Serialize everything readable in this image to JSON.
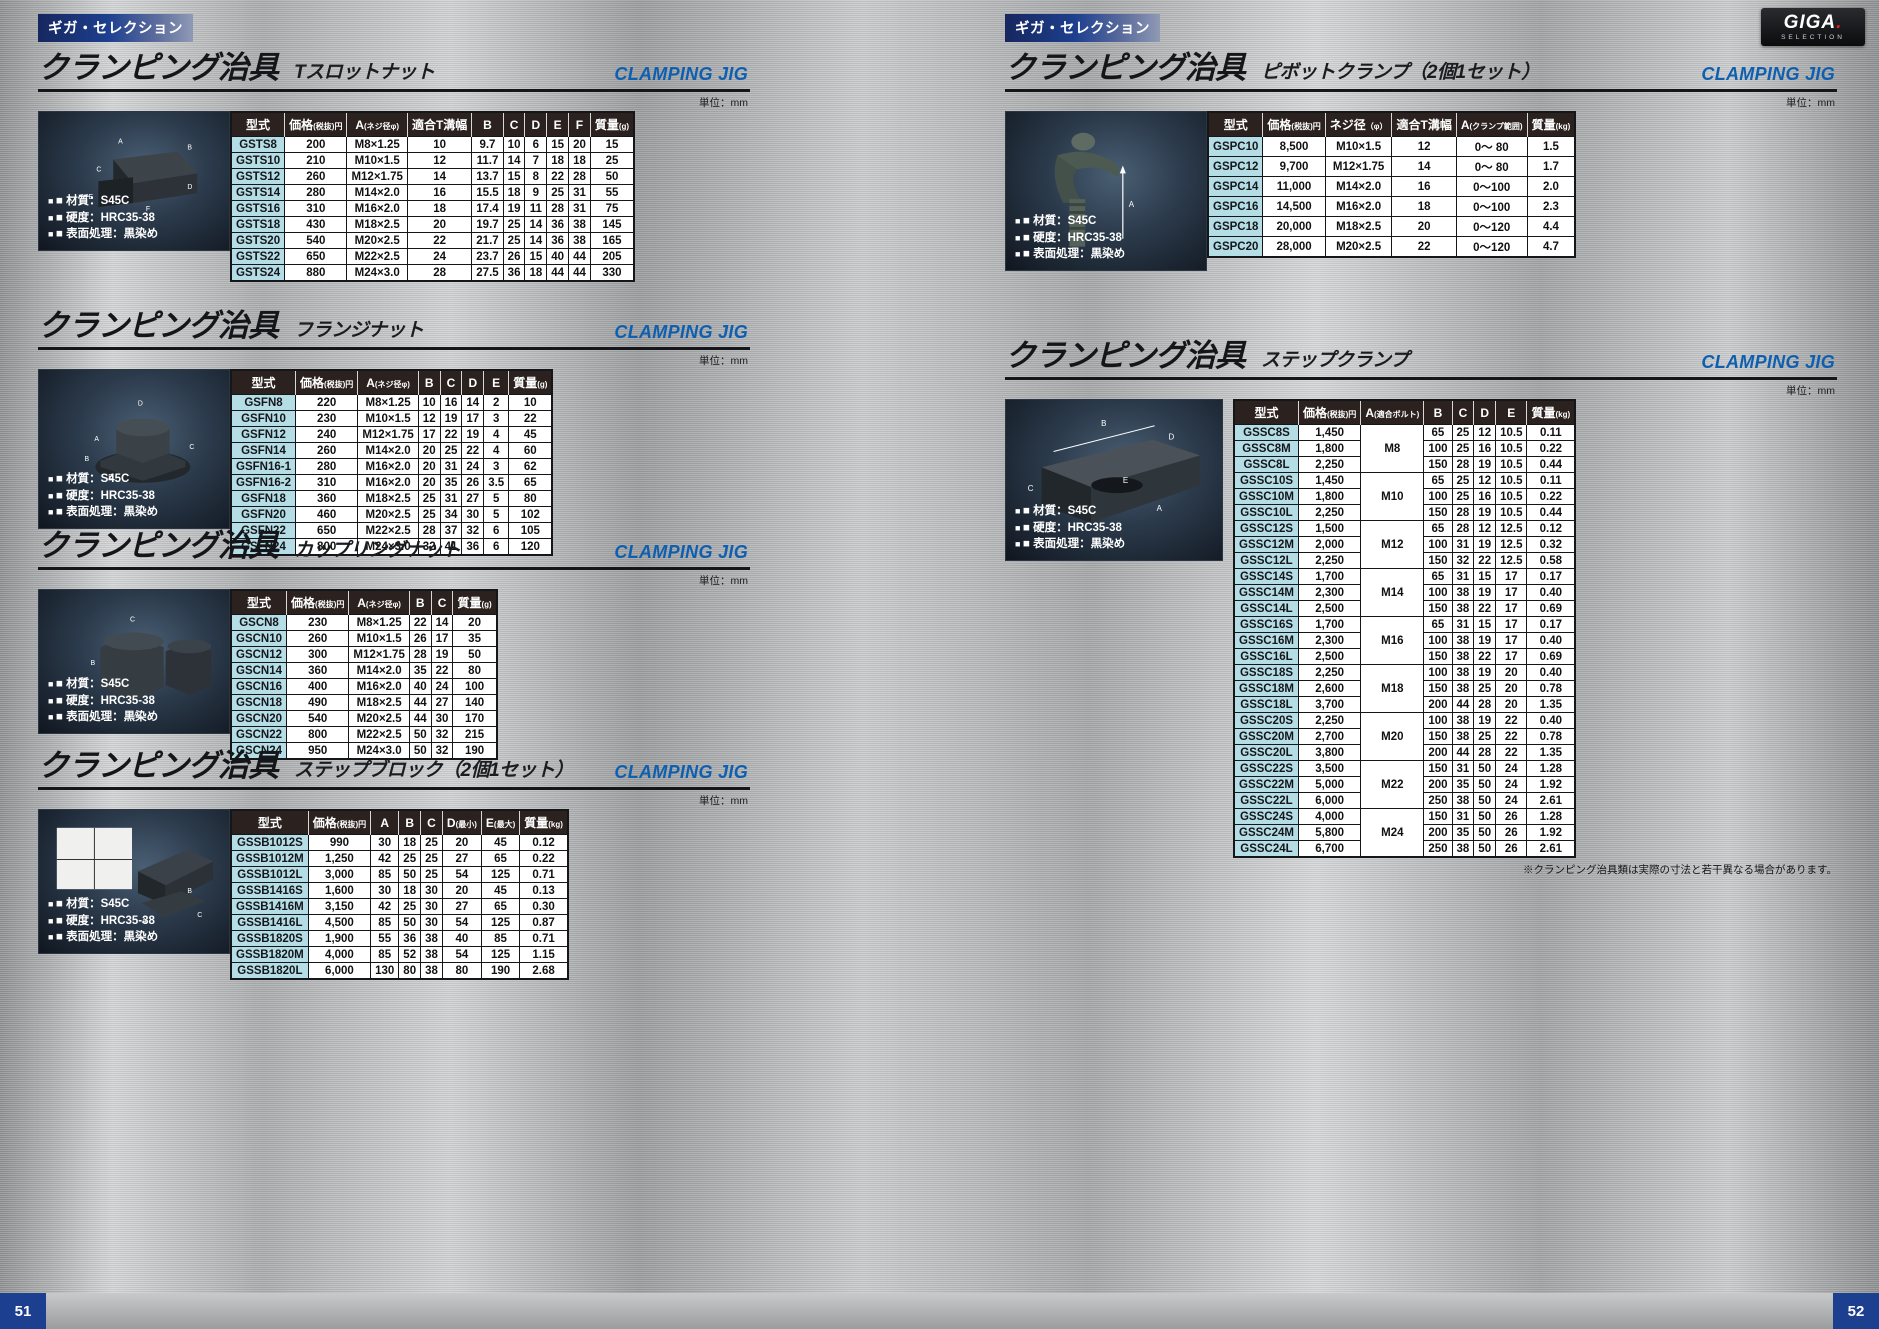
{
  "brand": {
    "tab_label": "ギガ・セレクション",
    "logo_main": "GIGA",
    "logo_sub": "SELECTION"
  },
  "pages": {
    "left": "51",
    "right": "52"
  },
  "common": {
    "unit_note": "単位：mm",
    "material": "■ 材質：S45C",
    "hardness": "■ 硬度：HRC35-38",
    "finish": "■ 表面処理：黒染め",
    "clamping_jig_en": "CLAMPING JIG",
    "title_main": "クランピング治具"
  },
  "sections": [
    {
      "id": "t-slot-nut",
      "title_main": "クランピング治具",
      "title_sub": "Tスロットナット",
      "title_en": "CLAMPING JIG",
      "unit_note": "単位：mm",
      "has_brand_tab": true,
      "headers": [
        "型式",
        "価格(税抜)円",
        "A(ネジ径φ)",
        "適合T溝幅",
        "B",
        "C",
        "D",
        "E",
        "F",
        "質量(g)"
      ],
      "rows": [
        [
          "GSTS8",
          "200",
          "M8×1.25",
          "10",
          "9.7",
          "10",
          "6",
          "15",
          "20",
          "15"
        ],
        [
          "GSTS10",
          "210",
          "M10×1.5",
          "12",
          "11.7",
          "14",
          "7",
          "18",
          "18",
          "25"
        ],
        [
          "GSTS12",
          "260",
          "M12×1.75",
          "14",
          "13.7",
          "15",
          "8",
          "22",
          "28",
          "50"
        ],
        [
          "GSTS14",
          "280",
          "M14×2.0",
          "16",
          "15.5",
          "18",
          "9",
          "25",
          "31",
          "55"
        ],
        [
          "GSTS16",
          "310",
          "M16×2.0",
          "18",
          "17.4",
          "19",
          "11",
          "28",
          "31",
          "75"
        ],
        [
          "GSTS18",
          "430",
          "M18×2.5",
          "20",
          "19.7",
          "25",
          "14",
          "36",
          "38",
          "145"
        ],
        [
          "GSTS20",
          "540",
          "M20×2.5",
          "22",
          "21.7",
          "25",
          "14",
          "36",
          "38",
          "165"
        ],
        [
          "GSTS22",
          "650",
          "M22×2.5",
          "24",
          "23.7",
          "26",
          "15",
          "40",
          "44",
          "205"
        ],
        [
          "GSTS24",
          "880",
          "M24×3.0",
          "28",
          "27.5",
          "36",
          "18",
          "44",
          "44",
          "330"
        ]
      ],
      "specs": [
        "■ 材質：S45C",
        "■ 硬度：HRC35-38",
        "■ 表面処理：黒染め"
      ]
    },
    {
      "id": "flange-nut",
      "title_main": "クランピング治具",
      "title_sub": "フランジナット",
      "title_en": "CLAMPING JIG",
      "unit_note": "単位：mm",
      "has_brand_tab": false,
      "headers": [
        "型式",
        "価格(税抜)円",
        "A(ネジ径φ)",
        "B",
        "C",
        "D",
        "E",
        "質量(g)"
      ],
      "rows": [
        [
          "GSFN8",
          "220",
          "M8×1.25",
          "10",
          "16",
          "14",
          "2",
          "10"
        ],
        [
          "GSFN10",
          "230",
          "M10×1.5",
          "12",
          "19",
          "17",
          "3",
          "22"
        ],
        [
          "GSFN12",
          "240",
          "M12×1.75",
          "17",
          "22",
          "19",
          "4",
          "45"
        ],
        [
          "GSFN14",
          "260",
          "M14×2.0",
          "20",
          "25",
          "22",
          "4",
          "60"
        ],
        [
          "GSFN16-1",
          "280",
          "M16×2.0",
          "20",
          "31",
          "24",
          "3",
          "62"
        ],
        [
          "GSFN16-2",
          "310",
          "M16×2.0",
          "20",
          "35",
          "26",
          "3.5",
          "65"
        ],
        [
          "GSFN18",
          "360",
          "M18×2.5",
          "25",
          "31",
          "27",
          "5",
          "80"
        ],
        [
          "GSFN20",
          "460",
          "M20×2.5",
          "25",
          "34",
          "30",
          "5",
          "102"
        ],
        [
          "GSFN22",
          "650",
          "M22×2.5",
          "28",
          "37",
          "32",
          "6",
          "105"
        ],
        [
          "GSFN24",
          "800",
          "M24×3.0",
          "32",
          "41",
          "36",
          "6",
          "120"
        ]
      ],
      "specs": [
        "■ 材質：S45C",
        "■ 硬度：HRC35-38",
        "■ 表面処理：黒染め"
      ]
    },
    {
      "id": "coupling-nut",
      "title_main": "クランピング治具",
      "title_sub": "カップリングナット",
      "title_en": "CLAMPING JIG",
      "unit_note": "単位：mm",
      "has_brand_tab": false,
      "headers": [
        "型式",
        "価格(税抜)円",
        "A(ネジ径φ)",
        "B",
        "C",
        "質量(g)"
      ],
      "rows": [
        [
          "GSCN8",
          "230",
          "M8×1.25",
          "22",
          "14",
          "20"
        ],
        [
          "GSCN10",
          "260",
          "M10×1.5",
          "26",
          "17",
          "35"
        ],
        [
          "GSCN12",
          "300",
          "M12×1.75",
          "28",
          "19",
          "50"
        ],
        [
          "GSCN14",
          "360",
          "M14×2.0",
          "35",
          "22",
          "80"
        ],
        [
          "GSCN16",
          "400",
          "M16×2.0",
          "40",
          "24",
          "100"
        ],
        [
          "GSCN18",
          "490",
          "M18×2.5",
          "44",
          "27",
          "140"
        ],
        [
          "GSCN20",
          "540",
          "M20×2.5",
          "44",
          "30",
          "170"
        ],
        [
          "GSCN22",
          "800",
          "M22×2.5",
          "50",
          "32",
          "215"
        ],
        [
          "GSCN24",
          "950",
          "M24×3.0",
          "50",
          "32",
          "190"
        ]
      ],
      "specs": [
        "■ 材質：S45C",
        "■ 硬度：HRC35-38",
        "■ 表面処理：黒染め"
      ]
    },
    {
      "id": "step-block",
      "title_main": "クランピング治具",
      "title_sub": "ステップブロック（2個1セット）",
      "title_en": "CLAMPING JIG",
      "unit_note": "単位：mm",
      "has_brand_tab": false,
      "headers": [
        "型式",
        "価格(税抜)円",
        "A",
        "B",
        "C",
        "D(最小)",
        "E(最大)",
        "質量(kg)"
      ],
      "rows": [
        [
          "GSSB1012S",
          "990",
          "30",
          "18",
          "25",
          "20",
          "45",
          "0.12"
        ],
        [
          "GSSB1012M",
          "1,250",
          "42",
          "25",
          "25",
          "27",
          "65",
          "0.22"
        ],
        [
          "GSSB1012L",
          "3,000",
          "85",
          "50",
          "25",
          "54",
          "125",
          "0.71"
        ],
        [
          "GSSB1416S",
          "1,600",
          "30",
          "18",
          "30",
          "20",
          "45",
          "0.13"
        ],
        [
          "GSSB1416M",
          "3,150",
          "42",
          "25",
          "30",
          "27",
          "65",
          "0.30"
        ],
        [
          "GSSB1416L",
          "4,500",
          "85",
          "50",
          "30",
          "54",
          "125",
          "0.87"
        ],
        [
          "GSSB1820S",
          "1,900",
          "55",
          "36",
          "38",
          "40",
          "85",
          "0.71"
        ],
        [
          "GSSB1820M",
          "4,000",
          "85",
          "52",
          "38",
          "54",
          "125",
          "1.15"
        ],
        [
          "GSSB1820L",
          "6,000",
          "130",
          "80",
          "38",
          "80",
          "190",
          "2.68"
        ]
      ],
      "specs": [
        "■ 材質：S45C",
        "■ 硬度：HRC35-38",
        "■ 表面処理：黒染め"
      ]
    },
    {
      "id": "pivot-clamp",
      "title_main": "クランピング治具",
      "title_sub": "ピボットクランプ（2個1セット）",
      "title_en": "CLAMPING JIG",
      "unit_note": "単位：mm",
      "has_brand_tab": true,
      "headers": [
        "型式",
        "価格(税抜)円",
        "ネジ径（φ）",
        "適合T溝幅",
        "A(クランプ範囲)",
        "質量(kg)"
      ],
      "rows": [
        [
          "GSPC10",
          "8,500",
          "M10×1.5",
          "12",
          "0～ 80",
          "1.5"
        ],
        [
          "GSPC12",
          "9,700",
          "M12×1.75",
          "14",
          "0～ 80",
          "1.7"
        ],
        [
          "GSPC14",
          "11,000",
          "M14×2.0",
          "16",
          "0～100",
          "2.0"
        ],
        [
          "GSPC16",
          "14,500",
          "M16×2.0",
          "18",
          "0～100",
          "2.3"
        ],
        [
          "GSPC18",
          "20,000",
          "M18×2.5",
          "20",
          "0～120",
          "4.4"
        ],
        [
          "GSPC20",
          "28,000",
          "M20×2.5",
          "22",
          "0～120",
          "4.7"
        ]
      ],
      "specs": [
        "■ 材質：S45C",
        "■ 硬度：HRC35-38",
        "■ 表面処理：黒染め"
      ]
    },
    {
      "id": "step-clamp",
      "title_main": "クランピング治具",
      "title_sub": "ステップクランプ",
      "title_en": "CLAMPING JIG",
      "unit_note": "単位：mm",
      "has_brand_tab": false,
      "headers": [
        "型式",
        "価格(税抜)円",
        "A(適合ボルト)",
        "B",
        "C",
        "D",
        "E",
        "質量(kg)"
      ],
      "rows": [
        [
          "GSSC8S",
          "1,450",
          "M8",
          "65",
          "25",
          "12",
          "10.5",
          "0.11"
        ],
        [
          "GSSC8M",
          "1,800",
          "",
          "100",
          "25",
          "16",
          "10.5",
          "0.22"
        ],
        [
          "GSSC8L",
          "2,250",
          "",
          "150",
          "28",
          "19",
          "10.5",
          "0.44"
        ],
        [
          "GSSC10S",
          "1,450",
          "M10",
          "65",
          "25",
          "12",
          "10.5",
          "0.11"
        ],
        [
          "GSSC10M",
          "1,800",
          "",
          "100",
          "25",
          "16",
          "10.5",
          "0.22"
        ],
        [
          "GSSC10L",
          "2,250",
          "",
          "150",
          "28",
          "19",
          "10.5",
          "0.44"
        ],
        [
          "GSSC12S",
          "1,500",
          "M12",
          "65",
          "28",
          "12",
          "12.5",
          "0.12"
        ],
        [
          "GSSC12M",
          "2,000",
          "",
          "100",
          "31",
          "19",
          "12.5",
          "0.32"
        ],
        [
          "GSSC12L",
          "2,250",
          "",
          "150",
          "32",
          "22",
          "12.5",
          "0.58"
        ],
        [
          "GSSC14S",
          "1,700",
          "M14",
          "65",
          "31",
          "15",
          "17",
          "0.17"
        ],
        [
          "GSSC14M",
          "2,300",
          "",
          "100",
          "38",
          "19",
          "17",
          "0.40"
        ],
        [
          "GSSC14L",
          "2,500",
          "",
          "150",
          "38",
          "22",
          "17",
          "0.69"
        ],
        [
          "GSSC16S",
          "1,700",
          "M16",
          "65",
          "31",
          "15",
          "17",
          "0.17"
        ],
        [
          "GSSC16M",
          "2,300",
          "",
          "100",
          "38",
          "19",
          "17",
          "0.40"
        ],
        [
          "GSSC16L",
          "2,500",
          "",
          "150",
          "38",
          "22",
          "17",
          "0.69"
        ],
        [
          "GSSC18S",
          "2,250",
          "M18",
          "100",
          "38",
          "19",
          "20",
          "0.40"
        ],
        [
          "GSSC18M",
          "2,600",
          "",
          "150",
          "38",
          "25",
          "20",
          "0.78"
        ],
        [
          "GSSC18L",
          "3,700",
          "",
          "200",
          "44",
          "28",
          "20",
          "1.35"
        ],
        [
          "GSSC20S",
          "2,250",
          "M20",
          "100",
          "38",
          "19",
          "22",
          "0.40"
        ],
        [
          "GSSC20M",
          "2,700",
          "",
          "150",
          "38",
          "25",
          "22",
          "0.78"
        ],
        [
          "GSSC20L",
          "3,800",
          "",
          "200",
          "44",
          "28",
          "22",
          "1.35"
        ],
        [
          "GSSC22S",
          "3,500",
          "M22",
          "150",
          "31",
          "50",
          "24",
          "1.28"
        ],
        [
          "GSSC22M",
          "5,000",
          "",
          "200",
          "35",
          "50",
          "24",
          "1.92"
        ],
        [
          "GSSC22L",
          "6,000",
          "",
          "250",
          "38",
          "50",
          "24",
          "2.61"
        ],
        [
          "GSSC24S",
          "4,000",
          "M24",
          "150",
          "31",
          "50",
          "26",
          "1.28"
        ],
        [
          "GSSC24M",
          "5,800",
          "",
          "200",
          "35",
          "50",
          "26",
          "1.92"
        ],
        [
          "GSSC24L",
          "6,700",
          "",
          "250",
          "38",
          "50",
          "26",
          "2.61"
        ]
      ],
      "specs": [
        "■ 材質：S45C",
        "■ 硬度：HRC35-38",
        "■ 表面処理：黒染め"
      ],
      "footnote": "※クランピング治具類は実際の寸法と若干異なる場合があります。"
    }
  ]
}
